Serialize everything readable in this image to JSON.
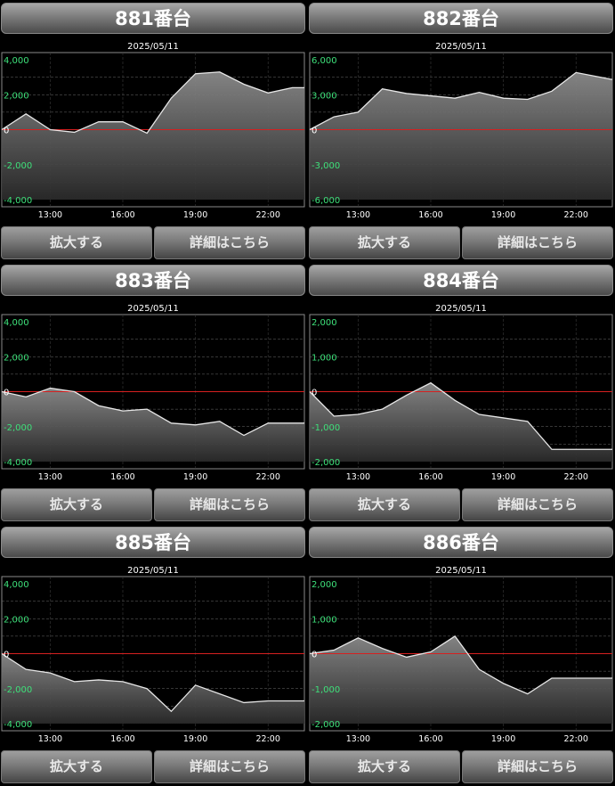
{
  "buttons": {
    "zoom": "拡大する",
    "detail": "詳細はこちら"
  },
  "colors": {
    "zero_line": "#d62020",
    "line": "#e6e6e6",
    "y_tick": "#3ee07a",
    "grid": "#6a6a6a"
  },
  "chart_data": [
    {
      "type": "area",
      "title": "881番台",
      "subtitle": "2025/05/11",
      "ylim": [
        -4000,
        4000
      ],
      "yticks": [
        4000,
        2000,
        0,
        -2000,
        -4000
      ],
      "ytick_labels": [
        "4,000",
        "2,000",
        "0",
        "-2,000",
        "-4,000"
      ],
      "xlim": [
        11,
        23.5
      ],
      "xticks": [
        13,
        16,
        19,
        22
      ],
      "xtick_labels": [
        "13:00",
        "16:00",
        "19:00",
        "22:00"
      ],
      "x": [
        11,
        12,
        13,
        14,
        15,
        16,
        17,
        18,
        19,
        20,
        21,
        22,
        23,
        23.5
      ],
      "values": [
        0,
        900,
        0,
        -150,
        450,
        450,
        -200,
        1800,
        3200,
        3300,
        2600,
        2100,
        2400,
        2400
      ]
    },
    {
      "type": "area",
      "title": "882番台",
      "subtitle": "2025/05/11",
      "ylim": [
        -6000,
        6000
      ],
      "yticks": [
        6000,
        3000,
        0,
        -3000,
        -6000
      ],
      "ytick_labels": [
        "6,000",
        "3,000",
        "0",
        "-3,000",
        "-6,000"
      ],
      "xlim": [
        11,
        23.5
      ],
      "xticks": [
        13,
        16,
        19,
        22
      ],
      "xtick_labels": [
        "13:00",
        "16:00",
        "19:00",
        "22:00"
      ],
      "x": [
        11,
        12,
        13,
        14,
        15,
        16,
        17,
        18,
        19,
        20,
        21,
        22,
        23,
        23.5
      ],
      "values": [
        0,
        1100,
        1500,
        3500,
        3100,
        2900,
        2700,
        3200,
        2700,
        2600,
        3300,
        4900,
        4500,
        4300
      ]
    },
    {
      "type": "area",
      "title": "883番台",
      "subtitle": "2025/05/11",
      "ylim": [
        -4000,
        4000
      ],
      "yticks": [
        4000,
        2000,
        0,
        -2000,
        -4000
      ],
      "ytick_labels": [
        "4,000",
        "2,000",
        "0",
        "-2,000",
        "-4,000"
      ],
      "xlim": [
        11,
        23.5
      ],
      "xticks": [
        13,
        16,
        19,
        22
      ],
      "xtick_labels": [
        "13:00",
        "16:00",
        "19:00",
        "22:00"
      ],
      "x": [
        11,
        12,
        13,
        14,
        15,
        16,
        17,
        18,
        19,
        20,
        21,
        22,
        23,
        23.5
      ],
      "values": [
        0,
        -300,
        200,
        0,
        -800,
        -1100,
        -1000,
        -1800,
        -1900,
        -1700,
        -2500,
        -1800,
        -1800,
        -1800
      ]
    },
    {
      "type": "area",
      "title": "884番台",
      "subtitle": "2025/05/11",
      "ylim": [
        -2000,
        2000
      ],
      "yticks": [
        2000,
        1000,
        0,
        -1000,
        -2000
      ],
      "ytick_labels": [
        "2,000",
        "1,000",
        "0",
        "-1,000",
        "-2,000"
      ],
      "xlim": [
        11,
        23.5
      ],
      "xticks": [
        13,
        16,
        19,
        22
      ],
      "xtick_labels": [
        "13:00",
        "16:00",
        "19:00",
        "22:00"
      ],
      "x": [
        11,
        12,
        13,
        14,
        15,
        16,
        17,
        18,
        19,
        20,
        21,
        22,
        23,
        23.5
      ],
      "values": [
        0,
        -700,
        -650,
        -500,
        -100,
        250,
        -250,
        -650,
        -750,
        -850,
        -1650,
        -1650,
        -1650,
        -1650
      ]
    },
    {
      "type": "area",
      "title": "885番台",
      "subtitle": "2025/05/11",
      "ylim": [
        -4000,
        4000
      ],
      "yticks": [
        4000,
        2000,
        0,
        -2000,
        -4000
      ],
      "ytick_labels": [
        "4,000",
        "2,000",
        "0",
        "-2,000",
        "-4,000"
      ],
      "xlim": [
        11,
        23.5
      ],
      "xticks": [
        13,
        16,
        19,
        22
      ],
      "xtick_labels": [
        "13:00",
        "16:00",
        "19:00",
        "22:00"
      ],
      "x": [
        11,
        12,
        13,
        14,
        15,
        16,
        17,
        18,
        19,
        20,
        21,
        22,
        23,
        23.5
      ],
      "values": [
        0,
        -900,
        -1100,
        -1600,
        -1500,
        -1600,
        -2000,
        -3300,
        -1800,
        -2300,
        -2800,
        -2700,
        -2700,
        -2700
      ]
    },
    {
      "type": "area",
      "title": "886番台",
      "subtitle": "2025/05/11",
      "ylim": [
        -2000,
        2000
      ],
      "yticks": [
        2000,
        1000,
        0,
        -1000,
        -2000
      ],
      "ytick_labels": [
        "2,000",
        "1,000",
        "0",
        "-1,000",
        "-2,000"
      ],
      "xlim": [
        11,
        23.5
      ],
      "xticks": [
        13,
        16,
        19,
        22
      ],
      "xtick_labels": [
        "13:00",
        "16:00",
        "19:00",
        "22:00"
      ],
      "x": [
        11,
        12,
        13,
        14,
        15,
        16,
        17,
        18,
        19,
        20,
        21,
        22,
        23,
        23.5
      ],
      "values": [
        0,
        100,
        450,
        150,
        -100,
        50,
        500,
        -450,
        -850,
        -1150,
        -700,
        -700,
        -700,
        -700
      ]
    }
  ]
}
